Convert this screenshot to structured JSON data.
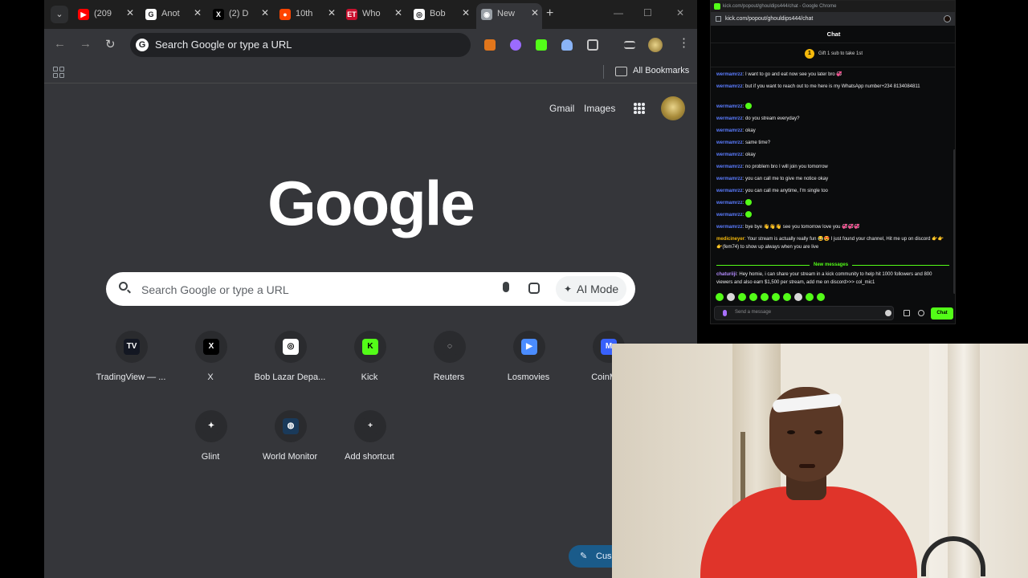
{
  "browser": {
    "tabs": [
      {
        "label": "(209",
        "favicon": "youtube-icon",
        "color": "#ff0000",
        "glyph": "▶"
      },
      {
        "label": "Anot",
        "favicon": "google-icon",
        "color": "#ffffff",
        "glyph": "G"
      },
      {
        "label": "(2) D",
        "favicon": "x-icon",
        "color": "#000000",
        "glyph": "X"
      },
      {
        "label": "10th",
        "favicon": "reddit-icon",
        "color": "#ff4500",
        "glyph": "●"
      },
      {
        "label": "Who",
        "favicon": "et-icon",
        "color": "#c8102e",
        "glyph": "ET"
      },
      {
        "label": "Bob",
        "favicon": "chatgpt-icon",
        "color": "#ffffff",
        "glyph": "◎"
      },
      {
        "label": "New",
        "favicon": "chrome-icon",
        "color": "#9aa0a6",
        "glyph": "◉",
        "active": true
      }
    ],
    "omnibox_placeholder": "Search Google or type a URL",
    "bookmarks_label": "All Bookmarks"
  },
  "ntp": {
    "gmail_label": "Gmail",
    "images_label": "Images",
    "logo_text": "Google",
    "search_placeholder": "Search Google or type a URL",
    "ai_mode_label": "AI Mode",
    "shortcuts": [
      {
        "label": "TradingView — ...",
        "icon": "tradingview-icon",
        "glyph": "TV",
        "bg": "#131722"
      },
      {
        "label": "X",
        "icon": "x-icon",
        "glyph": "X",
        "bg": "#000000"
      },
      {
        "label": "Bob Lazar Depa...",
        "icon": "chatgpt-icon",
        "glyph": "◎",
        "bg": "#ffffff"
      },
      {
        "label": "Kick",
        "icon": "kick-icon",
        "glyph": "K",
        "bg": "#53fc18"
      },
      {
        "label": "Reuters",
        "icon": "reuters-icon",
        "glyph": "◌",
        "bg": "#2a2b2e"
      },
      {
        "label": "Losmovies",
        "icon": "losmovies-icon",
        "glyph": "▶",
        "bg": "#4a8cff"
      },
      {
        "label": "CoinMar",
        "icon": "coinmarketcap-icon",
        "glyph": "M",
        "bg": "#3861fb"
      },
      {
        "label": "Glint",
        "icon": "glint-icon",
        "glyph": "✦",
        "bg": "#2a2b2e"
      },
      {
        "label": "World Monitor",
        "icon": "globe-icon",
        "glyph": "◍",
        "bg": "#1a3a5a"
      },
      {
        "label": "Add shortcut",
        "icon": "plus-icon",
        "glyph": "+",
        "bg": "#2a2b2e"
      }
    ],
    "customize_label": "Cus"
  },
  "chat_window": {
    "window_title": "kick.com/popout/ghouldips444/chat - Google Chrome",
    "url": "kick.com/popout/ghouldips444/chat",
    "header": "Chat",
    "gift_count": "1",
    "gift_label": "Gift 1 sub to take 1st",
    "messages": [
      {
        "user": "wermamrzz",
        "text": "I want to go and eat now see you later bro 💞",
        "user_color": "#5b7cff"
      },
      {
        "user": "wermamrzz",
        "text": "but if you want to reach out to me here is my WhatsApp number+234 8134084811",
        "user_color": "#5b7cff"
      },
      {
        "user": "wermamrzz",
        "text": "",
        "emotes": [
          "green"
        ],
        "user_color": "#5b7cff"
      },
      {
        "user": "wermamrzz",
        "text": "do you stream everyday?",
        "user_color": "#5b7cff"
      },
      {
        "user": "wermamrzz",
        "text": "okay",
        "user_color": "#5b7cff"
      },
      {
        "user": "wermamrzz",
        "text": "same time?",
        "user_color": "#5b7cff"
      },
      {
        "user": "wermamrzz",
        "text": "okay",
        "user_color": "#5b7cff"
      },
      {
        "user": "wermamrzz",
        "text": "no problem bro I will join you tomorrow",
        "user_color": "#5b7cff"
      },
      {
        "user": "wermamrzz",
        "text": "you can call me to give me notice okay",
        "user_color": "#5b7cff"
      },
      {
        "user": "wermamrzz",
        "text": "you can call me anytime, I'm single too",
        "user_color": "#5b7cff"
      },
      {
        "user": "wermamrzz",
        "text": "",
        "emotes": [
          "green"
        ],
        "user_color": "#5b7cff"
      },
      {
        "user": "wermamrzz",
        "text": "",
        "emotes": [
          "green"
        ],
        "user_color": "#5b7cff"
      },
      {
        "user": "wermamrzz",
        "text": "bye bye 👋👋👋 see you tomorrow love you 💞💞💞",
        "user_color": "#5b7cff"
      },
      {
        "user": "medicineyer",
        "text": "Your stream is actually really fun 😂😍 I just found your channel, Hit me up on discord 👉👉👉(fem74) to show up always when you are live",
        "user_color": "#f5b90b"
      }
    ],
    "new_messages_label": "New messages",
    "new_message": {
      "user": "chaturiiji",
      "text": "Hey homie, i can share your stream in a kick community to help hit 1000 followers and 800 viewers and also earn $1,500 per stream, add me on discord>>> col_mic1",
      "user_color": "#b48cff"
    },
    "input_placeholder": "Send a message",
    "send_label": "Chat"
  }
}
